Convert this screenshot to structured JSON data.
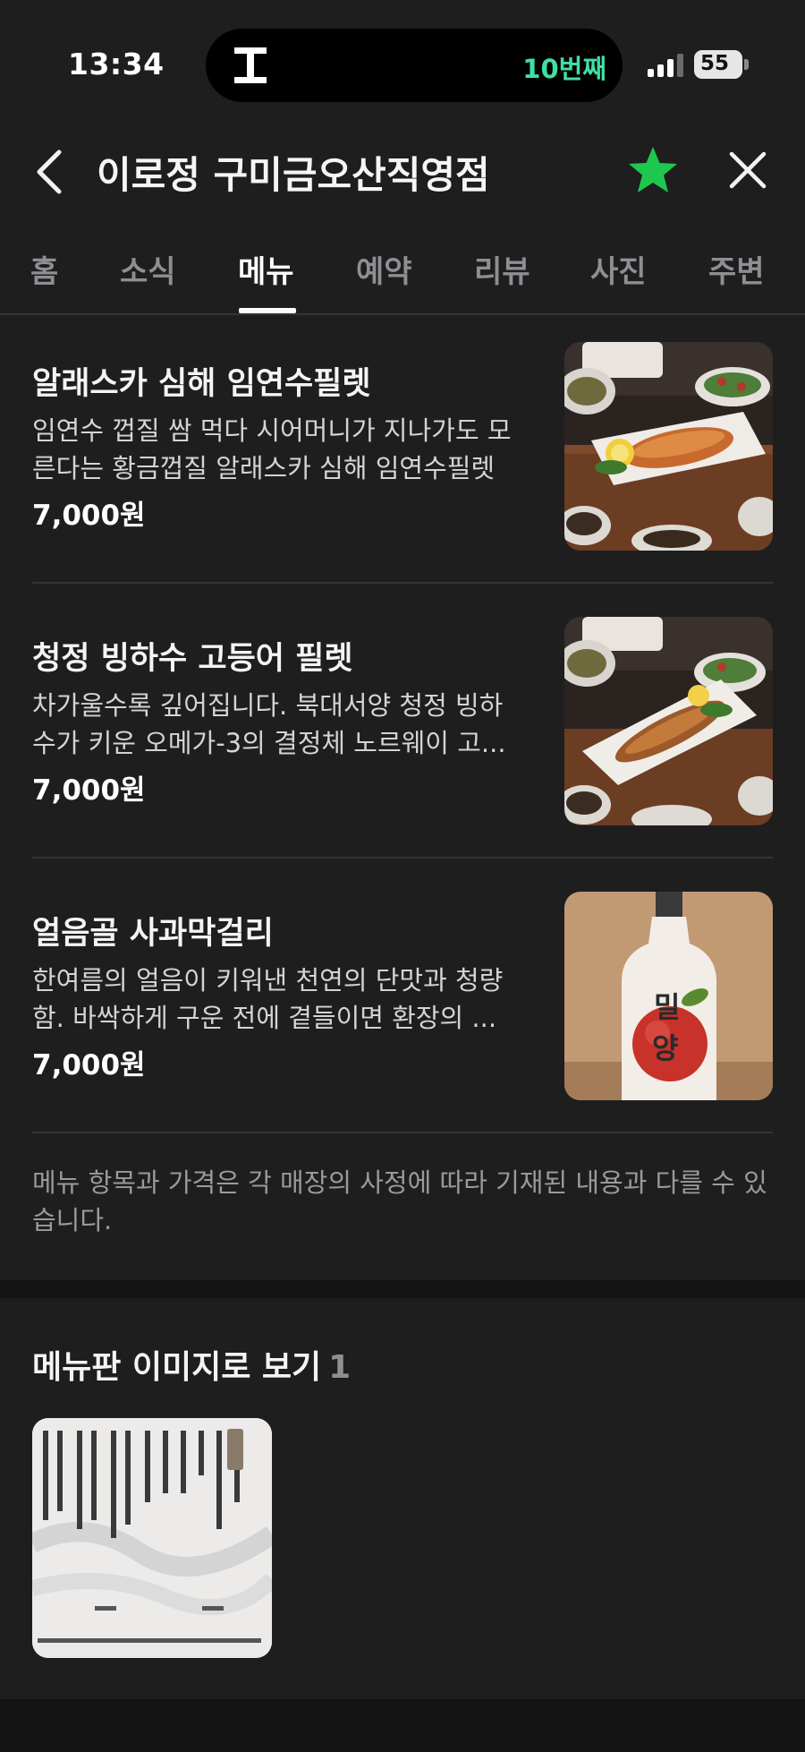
{
  "status_bar": {
    "time": "13:34",
    "rank_badge": "10번째",
    "battery": "55",
    "accent": "#3fe0a5"
  },
  "header": {
    "title": "이로정 구미금오산직영점",
    "back_icon": "chevron-left-icon",
    "favorite_icon": "star-icon",
    "favorite_color": "#1ec84e",
    "close_icon": "close-icon"
  },
  "tabs": [
    {
      "label": "홈",
      "active": false
    },
    {
      "label": "소식",
      "active": false
    },
    {
      "label": "메뉴",
      "active": true
    },
    {
      "label": "예약",
      "active": false
    },
    {
      "label": "리뷰",
      "active": false
    },
    {
      "label": "사진",
      "active": false
    },
    {
      "label": "주변",
      "active": false
    }
  ],
  "menu_items": [
    {
      "name": "알래스카 심해 임연수필렛",
      "desc_lines": [
        "임연수 껍질 쌈 먹다 시어머니가 지나가도 모",
        "른다는 황금껍질 알래스카 심해 임연수필렛"
      ],
      "price": "7,000원",
      "image": "grilled-atka-mackerel-photo"
    },
    {
      "name": "청정 빙하수 고등어 필렛",
      "desc_lines": [
        "차가울수록 깊어집니다. 북대서양 청정 빙하",
        "수가 키운 오메가-3의 결정체 노르웨이 고..."
      ],
      "price": "7,000원",
      "image": "grilled-mackerel-photo"
    },
    {
      "name": "얼음골 사과막걸리",
      "desc_lines": [
        "한여름의 얼음이 키워낸 천연의 단맛과 청량",
        "함. 바싹하게 구운 전에 곁들이면 환장의 ..."
      ],
      "price": "7,000원",
      "image": "apple-makgeolli-bottle-photo"
    }
  ],
  "notice": "메뉴 항목과 가격은 각 매장의 사정에 따라 기재된 내용과 다를 수 있습니다.",
  "menu_board": {
    "title": "메뉴판 이미지로 보기",
    "count": "1",
    "image": "menu-board-photo"
  }
}
